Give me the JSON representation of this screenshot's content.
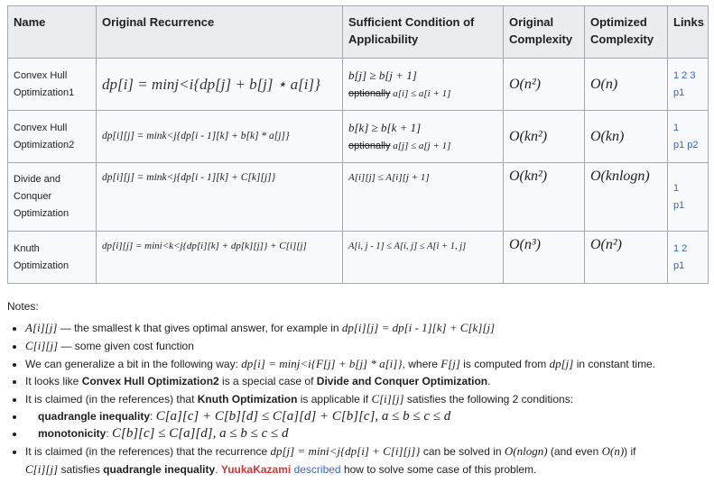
{
  "headers": {
    "name": "Name",
    "recurrence": "Original Recurrence",
    "condition_l1": "Sufficient Condition of",
    "condition_l2": "Applicability",
    "orig_l1": "Original",
    "orig_l2": "Complexity",
    "opt_l1": "Optimized",
    "opt_l2": "Complexity",
    "links": "Links"
  },
  "rows": [
    {
      "name_l1": "Convex Hull",
      "name_l2": "Optimization1",
      "recurrence": "dp[i] = minj<i{dp[j] + b[j] ⋆ a[i]}",
      "cond_l1": "b[j] ≥ b[j + 1]",
      "cond_opt": "optionally",
      "cond_l2": " a[i] ≤ a[i + 1]",
      "orig": "O(n²)",
      "opt": "O(n)",
      "links_l1": "1 2 3",
      "links_l2": "p1"
    },
    {
      "name_l1": "Convex Hull",
      "name_l2": "Optimization2",
      "recurrence": "dp[i][j] = mink<j{dp[i - 1][k] + b[k] * a[j]}",
      "cond_l1": "b[k] ≥ b[k + 1]",
      "cond_opt": "optionally",
      "cond_l2": " a[j] ≤ a[j + 1]",
      "orig": "O(kn²)",
      "opt": "O(kn)",
      "links_l1": "1",
      "links_l2": "p1 p2"
    },
    {
      "name_l1": "Divide and",
      "name_l2": "Conquer",
      "name_l3": "Optimization",
      "recurrence": "dp[i][j] = mink<j{dp[i - 1][k] + C[k][j]}",
      "cond_l1": "A[i][j] ≤ A[i][j + 1]",
      "orig": "O(kn²)",
      "opt": "O(knlogn)",
      "links_l1": "1",
      "links_l2": "p1"
    },
    {
      "name_l1": "Knuth",
      "name_l2": "Optimization",
      "recurrence": "dp[i][j] = mini<k<j{dp[i][k] + dp[k][j]} + C[i][j]",
      "cond_l1": "A[i, j - 1] ≤ A[i, j] ≤ A[i + 1, j]",
      "orig": "O(n³)",
      "opt": "O(n²)",
      "links_l1": "1 2",
      "links_l2": "p1"
    }
  ],
  "notes": {
    "title": "Notes:",
    "n1_math": "A[i][j]",
    "n1_text": " — the smallest k that gives optimal answer, for example in ",
    "n1_math2": "dp[i][j] = dp[i - 1][k] + C[k][j]",
    "n2_math": "C[i][j]",
    "n2_text": " — some given cost function",
    "n3_text": "We can generalize a bit in the following way: ",
    "n3_math": "dp[i] = minj<i{F[j] + b[j] * a[i]}",
    "n3_text2": ", where ",
    "n3_math2": "F[j]",
    "n3_text3": " is computed from ",
    "n3_math3": "dp[j]",
    "n3_text4": " in constant time.",
    "n4_text": "It looks like ",
    "n4_bold1": "Convex Hull Optimization2",
    "n4_text2": " is a special case of ",
    "n4_bold2": "Divide and Conquer Optimization",
    "n4_text3": ".",
    "n5_text": "It is claimed (in the references) that ",
    "n5_bold": "Knuth Optimization",
    "n5_text2": " is applicable if ",
    "n5_math": "C[i][j]",
    "n5_text3": " satisfies the following 2 conditions:",
    "s1_bold": "quadrangle inequality",
    "s1_math": "C[a][c] + C[b][d] ≤ C[a][d] + C[b][c], a ≤ b ≤ c ≤ d",
    "s2_bold": "monotonicity",
    "s2_math": "C[b][c] ≤ C[a][d], a ≤ b ≤ c ≤ d",
    "n6_text": "It is claimed (in the references) that the recurrence ",
    "n6_math": "dp[j] = mini<j{dp[i] + C[i][j]}",
    "n6_text2": " can be solved in ",
    "n6_math2": "O(nlogn)",
    "n6_text3": " (and even ",
    "n6_math3": "O(n)",
    "n6_text4": ") if",
    "n7_math": "C[i][j]",
    "n7_text": " satisfies ",
    "n7_bold": "quadrangle inequality",
    "n7_text2": ". ",
    "n7_user": "YuukaKazami",
    "n7_link": "described",
    "n7_text3": " how to solve some case of this problem."
  }
}
